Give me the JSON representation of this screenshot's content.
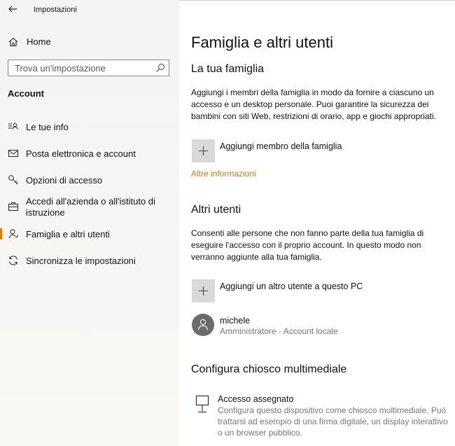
{
  "window": {
    "title": "Impostazioni"
  },
  "sidebar": {
    "home_label": "Home",
    "search_placeholder": "Trova un'impostazione",
    "section_label": "Account",
    "items": [
      {
        "label": "Le tue info",
        "icon": "person-card-icon"
      },
      {
        "label": "Posta elettronica e account",
        "icon": "mail-icon"
      },
      {
        "label": "Opzioni di accesso",
        "icon": "key-icon"
      },
      {
        "label": "Accedi all'azienda o all'istituto di istruzione",
        "icon": "briefcase-icon"
      },
      {
        "label": "Famiglia e altri utenti",
        "icon": "person-icon",
        "active": true
      },
      {
        "label": "Sincronizza le impostazioni",
        "icon": "sync-icon"
      }
    ]
  },
  "main": {
    "title": "Famiglia e altri utenti",
    "family": {
      "heading": "La tua famiglia",
      "description": "Aggiungi i membri della famiglia in modo da fornire a ciascuno un accesso e un desktop personale. Puoi garantire la sicurezza dei bambini con siti Web, restrizioni di orario, app e giochi appropriati.",
      "add_label": "Aggiungi membro della famiglia",
      "more_info": "Altre informazioni"
    },
    "others": {
      "heading": "Altri utenti",
      "description": "Consenti alle persone che non fanno parte della tua famiglia di eseguire l'accesso con il proprio account. In questo modo non verranno aggiunte alla tua famiglia.",
      "add_label": "Aggiungi un altro utente a questo PC",
      "user": {
        "name": "michele",
        "role": "Amministratore - Account locale"
      }
    },
    "kiosk": {
      "heading": "Configura chiosco multimediale",
      "title": "Accesso assegnato",
      "description": "Configura questo dispositivo come chiosco multimediale. Può trattarsi ad esempio di una firma digitale, un display interattivo o un browser pubblico."
    }
  },
  "colors": {
    "accent": "#e07a10",
    "link": "#c07a14",
    "tile": "#d9d9d9"
  }
}
